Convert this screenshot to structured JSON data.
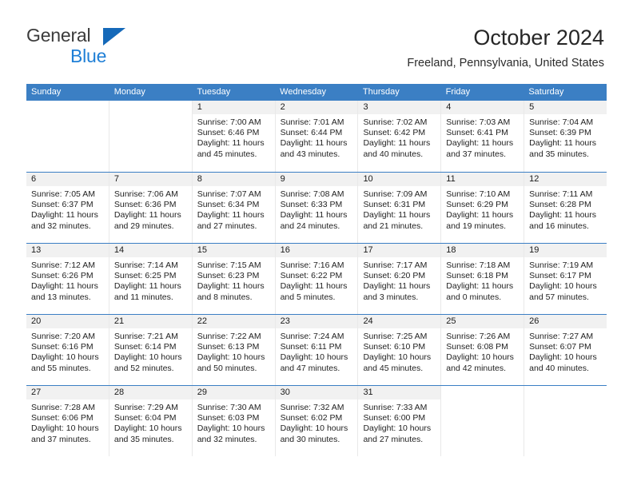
{
  "brand": {
    "line1": "General",
    "line2": "Blue",
    "triangle_color": "#1569b9",
    "line2_color": "#1f7fd6"
  },
  "header": {
    "title": "October 2024",
    "subtitle": "Freeland, Pennsylvania, United States"
  },
  "calendar": {
    "header_bg": "#3b7fc4",
    "daynum_bg": "#f1f1f1",
    "weekdays": [
      "Sunday",
      "Monday",
      "Tuesday",
      "Wednesday",
      "Thursday",
      "Friday",
      "Saturday"
    ],
    "weeks": [
      [
        {
          "day": "",
          "lines": []
        },
        {
          "day": "",
          "lines": []
        },
        {
          "day": "1",
          "lines": [
            "Sunrise: 7:00 AM",
            "Sunset: 6:46 PM",
            "Daylight: 11 hours",
            "and 45 minutes."
          ]
        },
        {
          "day": "2",
          "lines": [
            "Sunrise: 7:01 AM",
            "Sunset: 6:44 PM",
            "Daylight: 11 hours",
            "and 43 minutes."
          ]
        },
        {
          "day": "3",
          "lines": [
            "Sunrise: 7:02 AM",
            "Sunset: 6:42 PM",
            "Daylight: 11 hours",
            "and 40 minutes."
          ]
        },
        {
          "day": "4",
          "lines": [
            "Sunrise: 7:03 AM",
            "Sunset: 6:41 PM",
            "Daylight: 11 hours",
            "and 37 minutes."
          ]
        },
        {
          "day": "5",
          "lines": [
            "Sunrise: 7:04 AM",
            "Sunset: 6:39 PM",
            "Daylight: 11 hours",
            "and 35 minutes."
          ]
        }
      ],
      [
        {
          "day": "6",
          "lines": [
            "Sunrise: 7:05 AM",
            "Sunset: 6:37 PM",
            "Daylight: 11 hours",
            "and 32 minutes."
          ]
        },
        {
          "day": "7",
          "lines": [
            "Sunrise: 7:06 AM",
            "Sunset: 6:36 PM",
            "Daylight: 11 hours",
            "and 29 minutes."
          ]
        },
        {
          "day": "8",
          "lines": [
            "Sunrise: 7:07 AM",
            "Sunset: 6:34 PM",
            "Daylight: 11 hours",
            "and 27 minutes."
          ]
        },
        {
          "day": "9",
          "lines": [
            "Sunrise: 7:08 AM",
            "Sunset: 6:33 PM",
            "Daylight: 11 hours",
            "and 24 minutes."
          ]
        },
        {
          "day": "10",
          "lines": [
            "Sunrise: 7:09 AM",
            "Sunset: 6:31 PM",
            "Daylight: 11 hours",
            "and 21 minutes."
          ]
        },
        {
          "day": "11",
          "lines": [
            "Sunrise: 7:10 AM",
            "Sunset: 6:29 PM",
            "Daylight: 11 hours",
            "and 19 minutes."
          ]
        },
        {
          "day": "12",
          "lines": [
            "Sunrise: 7:11 AM",
            "Sunset: 6:28 PM",
            "Daylight: 11 hours",
            "and 16 minutes."
          ]
        }
      ],
      [
        {
          "day": "13",
          "lines": [
            "Sunrise: 7:12 AM",
            "Sunset: 6:26 PM",
            "Daylight: 11 hours",
            "and 13 minutes."
          ]
        },
        {
          "day": "14",
          "lines": [
            "Sunrise: 7:14 AM",
            "Sunset: 6:25 PM",
            "Daylight: 11 hours",
            "and 11 minutes."
          ]
        },
        {
          "day": "15",
          "lines": [
            "Sunrise: 7:15 AM",
            "Sunset: 6:23 PM",
            "Daylight: 11 hours",
            "and 8 minutes."
          ]
        },
        {
          "day": "16",
          "lines": [
            "Sunrise: 7:16 AM",
            "Sunset: 6:22 PM",
            "Daylight: 11 hours",
            "and 5 minutes."
          ]
        },
        {
          "day": "17",
          "lines": [
            "Sunrise: 7:17 AM",
            "Sunset: 6:20 PM",
            "Daylight: 11 hours",
            "and 3 minutes."
          ]
        },
        {
          "day": "18",
          "lines": [
            "Sunrise: 7:18 AM",
            "Sunset: 6:18 PM",
            "Daylight: 11 hours",
            "and 0 minutes."
          ]
        },
        {
          "day": "19",
          "lines": [
            "Sunrise: 7:19 AM",
            "Sunset: 6:17 PM",
            "Daylight: 10 hours",
            "and 57 minutes."
          ]
        }
      ],
      [
        {
          "day": "20",
          "lines": [
            "Sunrise: 7:20 AM",
            "Sunset: 6:16 PM",
            "Daylight: 10 hours",
            "and 55 minutes."
          ]
        },
        {
          "day": "21",
          "lines": [
            "Sunrise: 7:21 AM",
            "Sunset: 6:14 PM",
            "Daylight: 10 hours",
            "and 52 minutes."
          ]
        },
        {
          "day": "22",
          "lines": [
            "Sunrise: 7:22 AM",
            "Sunset: 6:13 PM",
            "Daylight: 10 hours",
            "and 50 minutes."
          ]
        },
        {
          "day": "23",
          "lines": [
            "Sunrise: 7:24 AM",
            "Sunset: 6:11 PM",
            "Daylight: 10 hours",
            "and 47 minutes."
          ]
        },
        {
          "day": "24",
          "lines": [
            "Sunrise: 7:25 AM",
            "Sunset: 6:10 PM",
            "Daylight: 10 hours",
            "and 45 minutes."
          ]
        },
        {
          "day": "25",
          "lines": [
            "Sunrise: 7:26 AM",
            "Sunset: 6:08 PM",
            "Daylight: 10 hours",
            "and 42 minutes."
          ]
        },
        {
          "day": "26",
          "lines": [
            "Sunrise: 7:27 AM",
            "Sunset: 6:07 PM",
            "Daylight: 10 hours",
            "and 40 minutes."
          ]
        }
      ],
      [
        {
          "day": "27",
          "lines": [
            "Sunrise: 7:28 AM",
            "Sunset: 6:06 PM",
            "Daylight: 10 hours",
            "and 37 minutes."
          ]
        },
        {
          "day": "28",
          "lines": [
            "Sunrise: 7:29 AM",
            "Sunset: 6:04 PM",
            "Daylight: 10 hours",
            "and 35 minutes."
          ]
        },
        {
          "day": "29",
          "lines": [
            "Sunrise: 7:30 AM",
            "Sunset: 6:03 PM",
            "Daylight: 10 hours",
            "and 32 minutes."
          ]
        },
        {
          "day": "30",
          "lines": [
            "Sunrise: 7:32 AM",
            "Sunset: 6:02 PM",
            "Daylight: 10 hours",
            "and 30 minutes."
          ]
        },
        {
          "day": "31",
          "lines": [
            "Sunrise: 7:33 AM",
            "Sunset: 6:00 PM",
            "Daylight: 10 hours",
            "and 27 minutes."
          ]
        },
        {
          "day": "",
          "lines": []
        },
        {
          "day": "",
          "lines": []
        }
      ]
    ]
  }
}
